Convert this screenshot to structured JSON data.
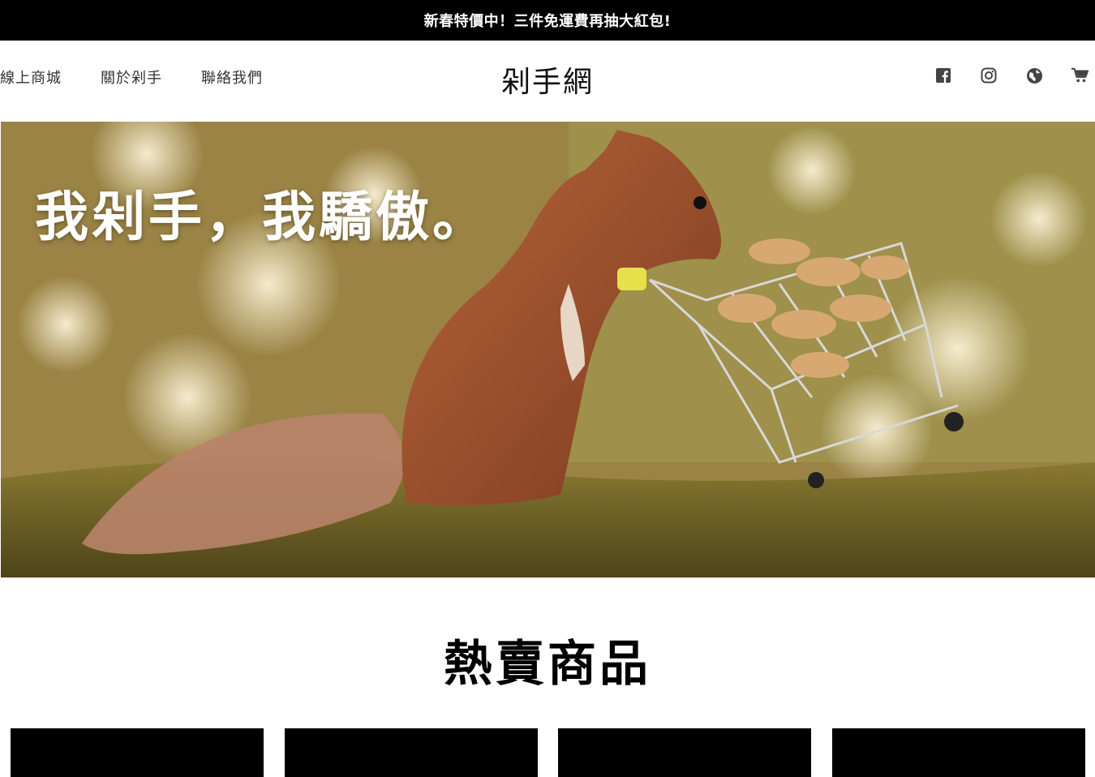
{
  "announcement": "新春特價中！三件免運費再抽大紅包!",
  "nav": {
    "links": [
      "線上商城",
      "關於剁手",
      "聯絡我們"
    ],
    "brand": "剁手網",
    "icons": [
      "facebook-icon",
      "instagram-icon",
      "globe-icon",
      "cart-icon"
    ]
  },
  "hero": {
    "title": "我剁手，我驕傲。",
    "image": "squirrel pushing shopping cart full of peanuts"
  },
  "section": {
    "title": "熱賣商品"
  },
  "products": [
    {},
    {},
    {},
    {}
  ],
  "colors": {
    "announcement_bg": "#000000",
    "announcement_text": "#ffffff",
    "nav_text": "#333333",
    "product_card": "#000000"
  }
}
